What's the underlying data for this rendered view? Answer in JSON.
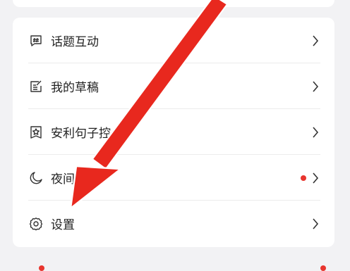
{
  "menu": {
    "items": [
      {
        "label": "话题互动",
        "icon": "topic-hash-icon"
      },
      {
        "label": "我的草稿",
        "icon": "draft-edit-icon"
      },
      {
        "label": "安利句子控",
        "icon": "star-badge-icon"
      },
      {
        "label": "夜间模式",
        "icon": "moon-icon",
        "badge": true
      },
      {
        "label": "设置",
        "icon": "gear-icon"
      }
    ]
  },
  "colors": {
    "accent_red": "#e8352e",
    "background": "#f2f2f4",
    "card": "#ffffff",
    "text": "#222222"
  }
}
